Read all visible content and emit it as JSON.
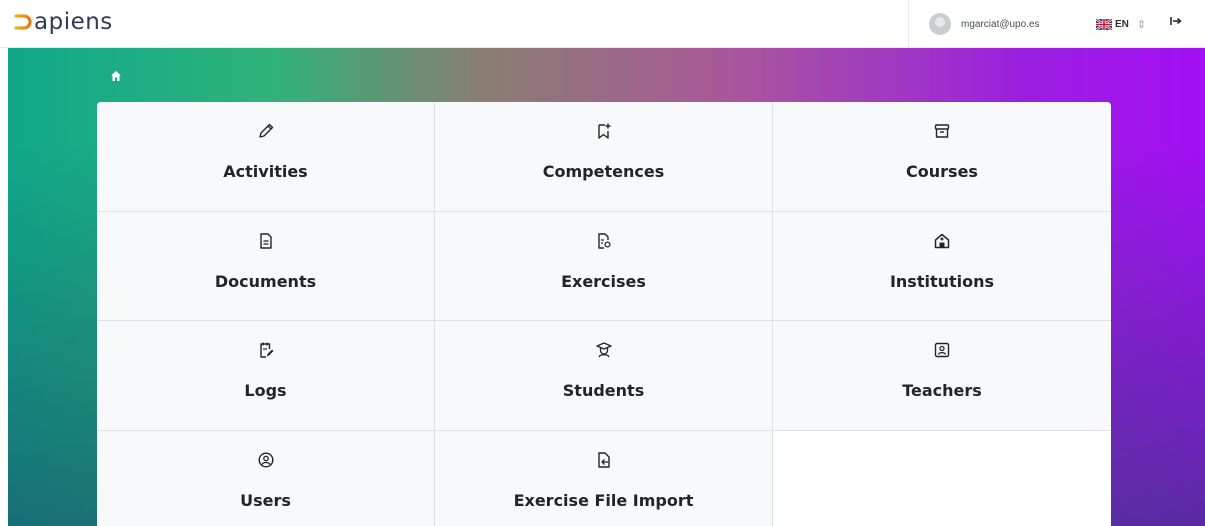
{
  "header": {
    "logo_text": "apiens",
    "user_email": "mgarciat@upo.es",
    "language": "EN"
  },
  "breadcrumb": {
    "home_icon": "home-icon"
  },
  "tiles": [
    {
      "label": "Activities",
      "icon": "pencil-icon"
    },
    {
      "label": "Competences",
      "icon": "bookmark-plus-icon"
    },
    {
      "label": "Courses",
      "icon": "archive-icon"
    },
    {
      "label": "Documents",
      "icon": "document-icon"
    },
    {
      "label": "Exercises",
      "icon": "file-search-icon"
    },
    {
      "label": "Institutions",
      "icon": "building-icon"
    },
    {
      "label": "Logs",
      "icon": "notes-edit-icon"
    },
    {
      "label": "Students",
      "icon": "student-icon"
    },
    {
      "label": "Teachers",
      "icon": "teacher-board-icon"
    },
    {
      "label": "Users",
      "icon": "user-circle-icon"
    },
    {
      "label": "Exercise File Import",
      "icon": "file-import-icon"
    }
  ],
  "colors": {
    "gradient_start": "#0fa98a",
    "gradient_mid": "#a9589a",
    "gradient_end": "#a40ff5",
    "tile_background": "#f8f9fa",
    "logo_accent": "#e8a020"
  }
}
